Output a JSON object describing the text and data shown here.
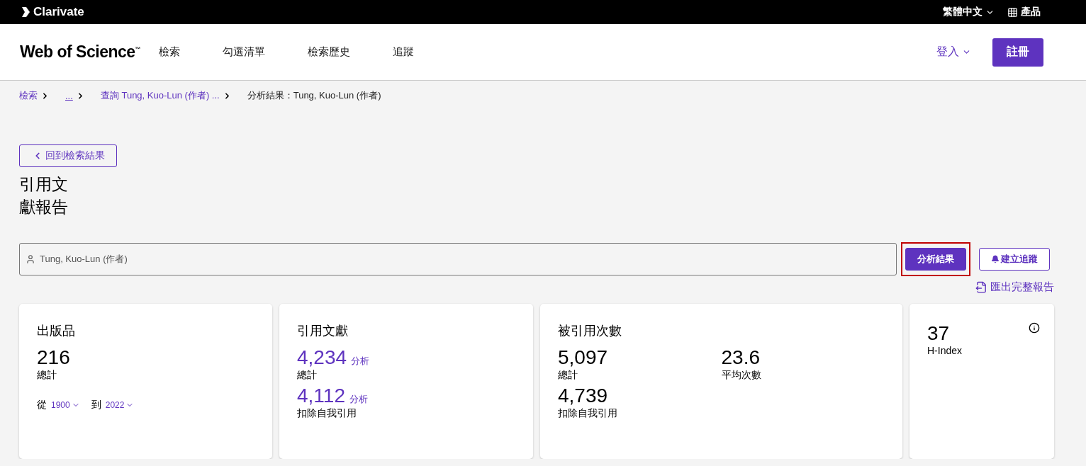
{
  "top_bar": {
    "brand": "Clarivate",
    "language": "繁體中文",
    "products": "產品"
  },
  "header": {
    "logo": "Web of Science",
    "logo_mark": "™",
    "nav": [
      "檢索",
      "勾選清單",
      "檢索歷史",
      "追蹤"
    ],
    "sign_in": "登入",
    "register": "註冊"
  },
  "breadcrumbs": [
    {
      "label": "檢索",
      "kind": "link"
    },
    {
      "label": "...",
      "kind": "ellipsis"
    },
    {
      "label": "查詢 Tung, Kuo-Lun (作者) ...",
      "kind": "link"
    },
    {
      "label": "分析結果：Tung, Kuo-Lun (作者)",
      "kind": "current"
    }
  ],
  "back_button": "回到檢索結果",
  "title_lines": [
    "引用文",
    "獻報告"
  ],
  "query": {
    "value": "Tung, Kuo-Lun (作者)"
  },
  "actions": [
    {
      "label": "分析結果",
      "kind": "primary",
      "highlighted": true
    },
    {
      "label": "建立追蹤",
      "kind": "outline",
      "highlighted": false
    }
  ],
  "export_link": "匯出完整報告",
  "publications": {
    "title": "出版品",
    "total": "216",
    "total_label": "總計",
    "from_label": "從",
    "from_year": "1900",
    "to_label": "到",
    "to_year": "2022"
  },
  "citing": {
    "title": "引用文獻",
    "items": [
      {
        "value": "4,234",
        "link": "分析",
        "label": "總計"
      },
      {
        "value": "4,112",
        "link": "分析",
        "label": "扣除自我引用"
      }
    ]
  },
  "times_cited": {
    "title": "被引用次數",
    "items": [
      {
        "value": "5,097",
        "label": "總計"
      },
      {
        "value": "23.6",
        "label": "平均次數"
      },
      {
        "value": "4,739",
        "label": "扣除自我引用"
      }
    ]
  },
  "h_index": {
    "value": "37",
    "label": "H-Index"
  }
}
